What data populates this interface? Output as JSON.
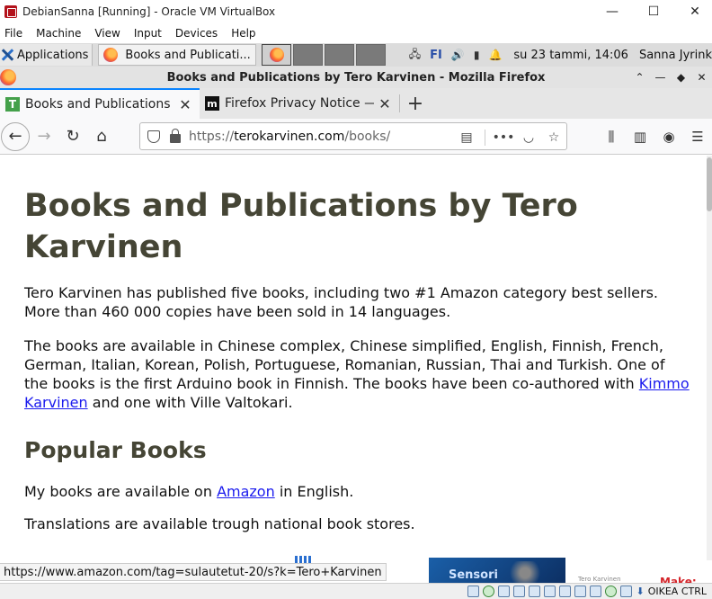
{
  "vbox": {
    "title": "DebianSanna [Running] - Oracle VM VirtualBox",
    "menu": [
      "File",
      "Machine",
      "View",
      "Input",
      "Devices",
      "Help"
    ],
    "window_controls": [
      "—",
      "☐",
      "✕"
    ],
    "status_host_key": "OIKEA CTRL"
  },
  "panel": {
    "applications_label": "Applications",
    "task_label": "Books and Publicati...",
    "keyboard_layout": "FI",
    "clock": "su 23 tammi, 14:06",
    "user": "Sanna Jyrink"
  },
  "firefox": {
    "window_title": "Books and Publications by Tero Karvinen - Mozilla Firefox",
    "window_controls": [
      "⌃",
      "—",
      "◆",
      "✕"
    ],
    "tabs": [
      {
        "label": "Books and Publications b",
        "favicon": "T"
      },
      {
        "label": "Firefox Privacy Notice —",
        "favicon": "m"
      }
    ],
    "url_prefix": "https://",
    "url_domain": "terokarvinen.com",
    "url_path": "/books/"
  },
  "page": {
    "title": "Books and Publications by Tero Karvinen",
    "intro": "Tero Karvinen has published five books, including two #1 Amazon category best sellers. More than 460 000 copies have been sold in 14 languages.",
    "languages_text_before": "The books are available in Chinese complex, Chinese simplified, English, Finnish, French, German, Italian, Korean, Polish, Portuguese, Romanian, Russian, Thai and Turkish. One of the books is the first Arduino book in Finnish. The books have been co-authored with ",
    "kimmo_link": "Kimmo Karvinen",
    "languages_text_after": " and one with Ville Valtokari.",
    "popular_heading": "Popular Books",
    "available_before": "My books are available on ",
    "amazon_link": "Amazon",
    "available_after": " in English.",
    "translations": "Translations are available trough national book stores.",
    "book_cover_text": "Sensori",
    "make_text": "Make:"
  },
  "status_url": "https://www.amazon.com/tag=sulautetut-20/s?k=Tero+Karvinen"
}
